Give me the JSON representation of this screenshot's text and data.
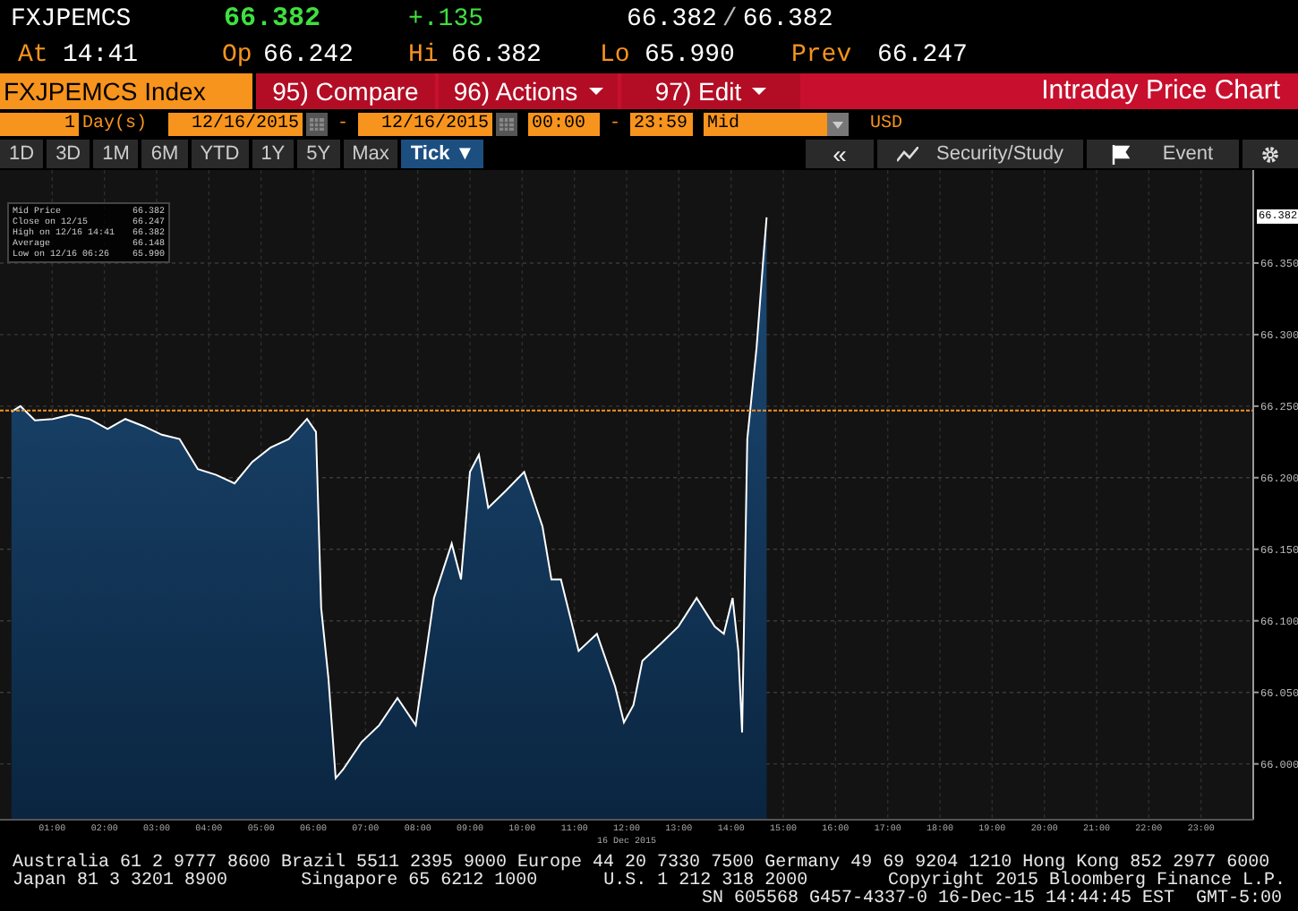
{
  "quote": {
    "ticker": "FXJPEMCS",
    "last": "66.382",
    "change": "+.135",
    "bid": "66.382",
    "separator": "/",
    "ask": "66.382"
  },
  "stats": [
    {
      "label": "At",
      "value": "14:41"
    },
    {
      "label": "Op",
      "value": "66.242"
    },
    {
      "label": "Hi",
      "value": "66.382"
    },
    {
      "label": "Lo",
      "value": "65.990"
    },
    {
      "label": "Prev",
      "value": "66.247"
    }
  ],
  "security": "FXJPEMCS Index",
  "menu": [
    {
      "label": "95) Compare",
      "dropdown": false
    },
    {
      "label": "96) Actions",
      "dropdown": true
    },
    {
      "label": "97) Edit",
      "dropdown": true
    }
  ],
  "screen_title": "Intraday Price Chart",
  "range": {
    "count": "1",
    "unit": "Day(s)",
    "start_date": "12/16/2015",
    "dash_1": "-",
    "end_date": "12/16/2015",
    "start_time": "00:00",
    "dash_2": "-",
    "end_time": "23:59",
    "price_type": "Mid",
    "currency": "USD"
  },
  "periods": [
    {
      "label": "1D",
      "selected": false
    },
    {
      "label": "3D",
      "selected": false
    },
    {
      "label": "1M",
      "selected": false
    },
    {
      "label": "6M",
      "selected": false
    },
    {
      "label": "YTD",
      "selected": false
    },
    {
      "label": "1Y",
      "selected": false
    },
    {
      "label": "5Y",
      "selected": false
    },
    {
      "label": "Max",
      "selected": false
    },
    {
      "label": "Tick ▼",
      "selected": true
    }
  ],
  "tools": [
    {
      "kind": "collapse",
      "label": "«"
    },
    {
      "kind": "study",
      "label": "Security/Study"
    },
    {
      "kind": "event",
      "label": "Event"
    },
    {
      "kind": "settings"
    }
  ],
  "legend": {
    "mid_value": "66.382",
    "items": [
      {
        "label": "Close on 12/15",
        "value": "66.247"
      },
      {
        "label": "High on 12/16 14:41",
        "value": "66.382"
      },
      {
        "label": "Average",
        "value": "66.148"
      },
      {
        "label": "Low on 12/16 06:26",
        "value": "65.990"
      }
    ]
  },
  "price_tag": "66.382",
  "chart_data": {
    "type": "area",
    "xlabel": "16 Dec 2015",
    "x": [
      0.22,
      0.39,
      0.67,
      1.01,
      1.36,
      1.71,
      2.06,
      2.4,
      2.75,
      3.1,
      3.44,
      3.79,
      4.14,
      4.49,
      4.83,
      5.18,
      5.53,
      5.88,
      6.05,
      6.15,
      6.29,
      6.43,
      6.57,
      6.92,
      7.26,
      7.61,
      7.96,
      8.31,
      8.65,
      8.83,
      9.0,
      9.17,
      9.35,
      9.69,
      10.04,
      10.39,
      10.56,
      10.74,
      11.08,
      11.43,
      11.78,
      11.95,
      12.13,
      12.3,
      12.65,
      12.99,
      13.34,
      13.69,
      13.86,
      14.03,
      14.14,
      14.21,
      14.31,
      14.49,
      14.62,
      14.68
    ],
    "series": [
      {
        "name": "Mid Price",
        "color": "#ffffff",
        "values": [
          66.246,
          66.25,
          66.24,
          66.241,
          66.244,
          66.241,
          66.234,
          66.241,
          66.236,
          66.23,
          66.227,
          66.206,
          66.202,
          66.196,
          66.211,
          66.221,
          66.227,
          66.241,
          66.232,
          66.109,
          66.059,
          65.99,
          65.996,
          66.015,
          66.027,
          66.046,
          66.027,
          66.116,
          66.154,
          66.129,
          66.204,
          66.216,
          66.179,
          66.191,
          66.204,
          66.166,
          66.129,
          66.129,
          66.079,
          66.091,
          66.054,
          66.029,
          66.041,
          66.072,
          66.084,
          66.096,
          66.116,
          66.096,
          66.091,
          66.116,
          66.079,
          66.022,
          66.227,
          66.291,
          66.354,
          66.382
        ]
      }
    ],
    "xlim": [
      0,
      24
    ],
    "ylim": [
      65.961,
      66.415
    ],
    "grid": true,
    "xticks": [
      {
        "value": 1,
        "label": "01:00"
      },
      {
        "value": 2,
        "label": "02:00"
      },
      {
        "value": 3,
        "label": "03:00"
      },
      {
        "value": 4,
        "label": "04:00"
      },
      {
        "value": 5,
        "label": "05:00"
      },
      {
        "value": 6,
        "label": "06:00"
      },
      {
        "value": 7,
        "label": "07:00"
      },
      {
        "value": 8,
        "label": "08:00"
      },
      {
        "value": 9,
        "label": "09:00"
      },
      {
        "value": 10,
        "label": "10:00"
      },
      {
        "value": 11,
        "label": "11:00"
      },
      {
        "value": 12,
        "label": "12:00"
      },
      {
        "value": 13,
        "label": "13:00"
      },
      {
        "value": 14,
        "label": "14:00"
      },
      {
        "value": 15,
        "label": "15:00"
      },
      {
        "value": 16,
        "label": "16:00"
      },
      {
        "value": 17,
        "label": "17:00"
      },
      {
        "value": 18,
        "label": "18:00"
      },
      {
        "value": 19,
        "label": "19:00"
      },
      {
        "value": 20,
        "label": "20:00"
      },
      {
        "value": 21,
        "label": "21:00"
      },
      {
        "value": 22,
        "label": "22:00"
      },
      {
        "value": 23,
        "label": "23:00"
      }
    ],
    "yticks": [
      {
        "value": 66.0,
        "label": "66.000"
      },
      {
        "value": 66.05,
        "label": "66.050"
      },
      {
        "value": 66.1,
        "label": "66.100"
      },
      {
        "value": 66.15,
        "label": "66.150"
      },
      {
        "value": 66.2,
        "label": "66.200"
      },
      {
        "value": 66.25,
        "label": "66.250"
      },
      {
        "value": 66.3,
        "label": "66.300"
      },
      {
        "value": 66.35,
        "label": "66.350"
      }
    ],
    "ref_lines": [
      {
        "axis": "y",
        "value": 66.247,
        "color": "#f7941d"
      }
    ]
  },
  "footer": {
    "line_1": "Australia 61 2 9777 8600 Brazil 5511 2395 9000 Europe 44 20 7330 7500 Germany 49 69 9204 1210 Hong Kong 852 2977 6000",
    "line_2": [
      "Japan 81 3 3201 8900",
      "Singapore 65 6212 1000",
      "U.S. 1 212 318 2000",
      "Copyright 2015 Bloomberg Finance L.P."
    ],
    "line_3": "SN 605568 G457-4337-0 16-Dec-15 14:44:45 EST  GMT-5:00"
  }
}
